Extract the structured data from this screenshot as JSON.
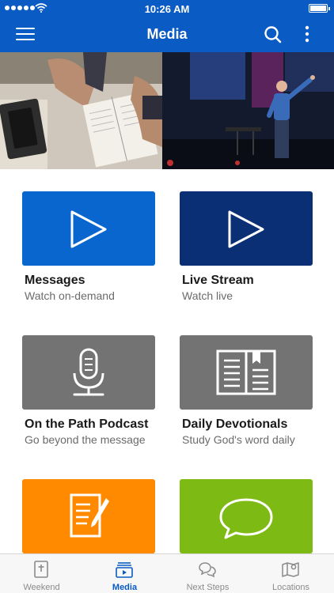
{
  "status_bar": {
    "time": "10:26 AM"
  },
  "header": {
    "title": "Media"
  },
  "tiles": [
    {
      "title": "Messages",
      "subtitle": "Watch on-demand",
      "color": "#0a66cf",
      "icon": "play-icon"
    },
    {
      "title": "Live Stream",
      "subtitle": "Watch live",
      "color": "#0b2f74",
      "icon": "play-icon"
    },
    {
      "title": "On the Path Podcast",
      "subtitle": "Go beyond the message",
      "color": "#737373",
      "icon": "microphone-icon"
    },
    {
      "title": "Daily Devotionals",
      "subtitle": "Study God's word daily",
      "color": "#737373",
      "icon": "open-book-icon"
    },
    {
      "title": "",
      "subtitle": "",
      "color": "#ff8a00",
      "icon": "notes-pencil-icon"
    },
    {
      "title": "",
      "subtitle": "",
      "color": "#7dba13",
      "icon": "chat-bubble-icon"
    }
  ],
  "tab_bar": {
    "active": "Media",
    "tabs": [
      {
        "label": "Weekend",
        "icon": "bible-icon"
      },
      {
        "label": "Media",
        "icon": "media-icon"
      },
      {
        "label": "Next Steps",
        "icon": "chat-bubbles-icon"
      },
      {
        "label": "Locations",
        "icon": "map-pin-icon"
      }
    ]
  },
  "colors": {
    "brand_blue": "#0a5bc4",
    "tab_inactive": "#8a8a8a"
  }
}
